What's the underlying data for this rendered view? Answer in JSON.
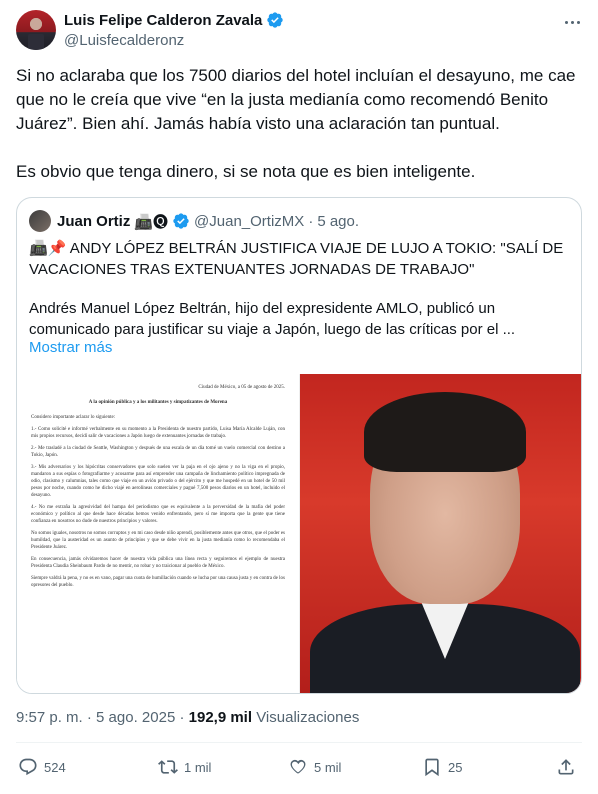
{
  "author": {
    "name": "Luis Felipe Calderon Zavala",
    "handle": "@Luisfecalderonz"
  },
  "body": {
    "paragraph1": "Si no aclaraba que los 7500 diarios del hotel incluían el desayuno, me cae que no le creía que vive “en la justa medianía como recomendó Benito Juárez”. Bien ahí. Jamás había visto una aclaración tan puntual.",
    "paragraph2": "Es obvio que tenga dinero, si se nota que es bien inteligente."
  },
  "quote": {
    "name": "Juan Ortiz",
    "emojis": "📠🅠",
    "handle": "@Juan_OrtizMX",
    "separator": "·",
    "time": "5 ago.",
    "title_emojis": "📠📌",
    "title": "ANDY LÓPEZ BELTRÁN JUSTIFICA VIAJE DE LUJO A TOKIO: \"SALÍ DE VACACIONES TRAS EXTENUANTES JORNADAS DE TRABAJO\"",
    "text": "Andrés Manuel López Beltrán, hijo del expresidente AMLO, publicó un comunicado para justificar su viaje a Japón, luego de las críticas por el ...",
    "show_more": "Mostrar más",
    "document": {
      "date": "Ciudad de México, a 05 de agosto de 2025.",
      "title": "A la opinión pública y a los militantes y simpatizantes de Morena",
      "paragraphs": [
        "Considero importante aclarar lo siguiente:",
        "1.- Como solicité e informé verbalmente en su momento a la Presidenta de nuestro partido, Luisa María Alcalde Luján, con mis propios recursos, decidí salir de vacaciones a Japón luego de extenuantes jornadas de trabajo.",
        "2.- Me trasladé a la ciudad de Seattle, Washington y después de una escala de un día tomé un vuelo comercial con destino a Tokio, Japón.",
        "3.- Mis adversarios y los hipócritas conservadores que solo suelen ver la paja en el ojo ajeno y no la viga en el propio, mandaron a sus espías o fotografiarme y acosarme para así emprender una campaña de linchamiento político impregnada de odio, clasismo y calumnias, tales como que viaje en un avión privado o del ejército y que me hospedé en un hotel de 50 mil pesos por noche, cuando como he dicho viajé en aerolíneas comerciales y pagué 7,500 pesos diarios en un hotel, incluido el desayuno.",
        "4.- No me extraña la agresividad del hampa del periodismo que es equivalente a la perversidad de la mafia del poder económico y político al que desde hace décadas hemos venido enfrentando, pero sí me importa que la gente que tiene confianza en nosotros no dude de nuestros principios y valores.",
        "No somos iguales, nosotros no somos corruptos y en mi caso desde niño aprendí, posiblemente antes que otros, que el poder es humildad, que la austeridad es un asunto de principios y que se debe vivir en la justa medianía como lo recomendaba el Presidente Juárez.",
        "En consecuencia, jamás olvidaremos hacer de nuestra vida pública una línea recta y seguiremos el ejemplo de nuestra Presidenta Claudia Sheinbaum Pardo de no mentir, no robar y no traicionar al pueblo de México.",
        "Siempre valdrá la pena, y no es en vano, pagar una cuota de humillación cuando se lucha por una causa justa y en contra de los opresores del pueblo."
      ]
    }
  },
  "meta": {
    "time": "9:57 p. m.",
    "separator": "·",
    "date": "5 ago. 2025",
    "views_count": "192,9 mil",
    "views_label": "Visualizaciones"
  },
  "actions": {
    "replies": "524",
    "reposts": "1 mil",
    "likes": "5 mil",
    "bookmarks": "25"
  },
  "colors": {
    "accent": "#1d9bf0",
    "text": "#0f1419",
    "muted": "#536471",
    "border": "#cfd9de"
  }
}
